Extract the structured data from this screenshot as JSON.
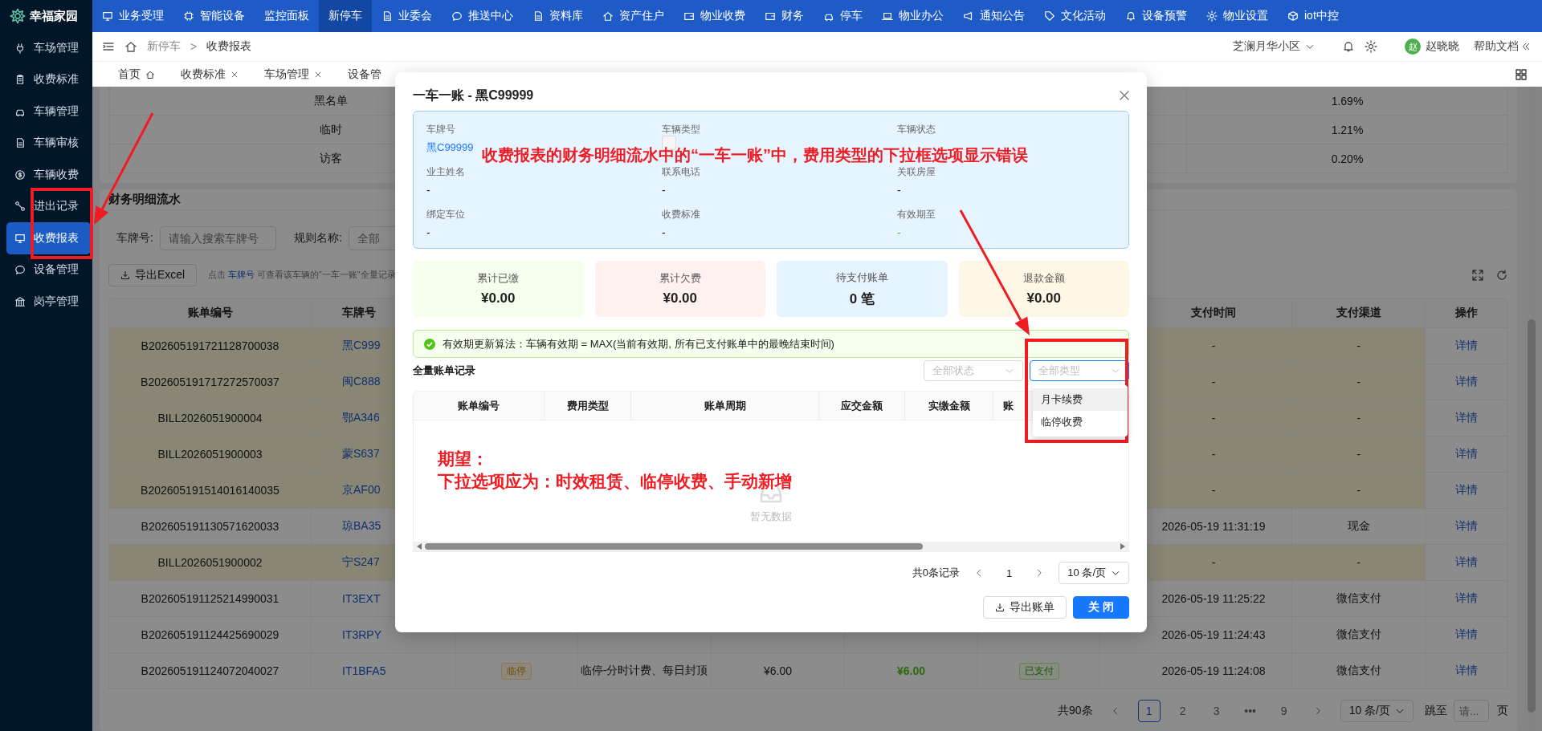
{
  "app": {
    "name": "幸福家园"
  },
  "top_nav": [
    {
      "label": "业务受理",
      "selected": false
    },
    {
      "label": "智能设备",
      "selected": false
    },
    {
      "label": "监控面板",
      "selected": false
    },
    {
      "label": "新停车",
      "selected": true
    },
    {
      "label": "业委会",
      "selected": false
    },
    {
      "label": "推送中心",
      "selected": false
    },
    {
      "label": "资料库",
      "selected": false
    },
    {
      "label": "资产住户",
      "selected": false
    },
    {
      "label": "物业收费",
      "selected": false
    },
    {
      "label": "财务",
      "selected": false
    },
    {
      "label": "停车",
      "selected": false
    },
    {
      "label": "物业办公",
      "selected": false
    },
    {
      "label": "通知公告",
      "selected": false
    },
    {
      "label": "文化活动",
      "selected": false
    },
    {
      "label": "设备预警",
      "selected": false
    },
    {
      "label": "物业设置",
      "selected": false
    },
    {
      "label": "iot中控",
      "selected": false
    }
  ],
  "sidebar": [
    {
      "label": "车场管理",
      "selected": false
    },
    {
      "label": "收费标准",
      "selected": false
    },
    {
      "label": "车辆管理",
      "selected": false
    },
    {
      "label": "车辆审核",
      "selected": false
    },
    {
      "label": "车辆收费",
      "selected": false
    },
    {
      "label": "进出记录",
      "selected": false
    },
    {
      "label": "收费报表",
      "selected": true
    },
    {
      "label": "设备管理",
      "selected": false
    },
    {
      "label": "岗亭管理",
      "selected": false
    }
  ],
  "breadcrumb": {
    "items": [
      "新停车",
      "收费报表"
    ],
    "separator": ">"
  },
  "header_right": {
    "community": "芝澜月华小区",
    "user_initial": "赵",
    "user_name": "赵晓晓",
    "help": "帮助文档"
  },
  "page_tabs": [
    {
      "label": "首页",
      "kind": "home",
      "closable": false
    },
    {
      "label": "收费标准",
      "kind": "page",
      "closable": true
    },
    {
      "label": "车场管理",
      "kind": "page",
      "closable": true
    },
    {
      "label": "设备管",
      "kind": "page",
      "closable": false
    }
  ],
  "summary_table": {
    "rows": [
      {
        "type": "黑名单",
        "ratio": "1.69%"
      },
      {
        "type": "临时",
        "ratio": "1.21%"
      },
      {
        "type": "访客",
        "ratio": "0.20%"
      }
    ]
  },
  "ledger": {
    "title": "财务明细流水",
    "filters": [
      {
        "label": "车牌号:",
        "placeholder": "请输入搜索车牌号"
      },
      {
        "label": "规则名称:",
        "placeholder": "全部"
      }
    ],
    "export_button": "导出Excel",
    "hint": {
      "before": "点击 ",
      "link": "车牌号",
      "after": " 可查看该车辆的\"一车一账\"全量记录"
    },
    "header": {
      "bill_no": "账单编号",
      "plate": "车牌号",
      "time": "支付时间",
      "channel": "支付渠道",
      "action": "操作"
    },
    "rows": [
      {
        "highlight": true,
        "bill_no": "B202605191721128700038",
        "plate": "黑C999",
        "time": "-",
        "channel": "-",
        "action": "详情"
      },
      {
        "highlight": true,
        "bill_no": "B202605191717272570037",
        "plate": "闽C888",
        "time": "-",
        "channel": "-",
        "action": "详情"
      },
      {
        "highlight": true,
        "bill_no": "BILL2026051900004",
        "plate": "鄂A346",
        "time": "-",
        "channel": "-",
        "action": "详情"
      },
      {
        "highlight": true,
        "bill_no": "BILL2026051900003",
        "plate": "蒙S637",
        "time": "-",
        "channel": "-",
        "action": "详情"
      },
      {
        "highlight": true,
        "bill_no": "B202605191514016140035",
        "plate": "京AF00",
        "time": "-",
        "channel": "-",
        "action": "详情"
      },
      {
        "highlight": false,
        "bill_no": "B202605191130571620033",
        "plate": "琼BA35",
        "time": "2026-05-19 11:31:19",
        "channel": "现金",
        "action": "详情"
      },
      {
        "highlight": true,
        "bill_no": "BILL2026051900002",
        "plate": "宁S247",
        "time": "-",
        "channel": "-",
        "action": "详情"
      },
      {
        "highlight": false,
        "bill_no": "B202605191125214990031",
        "plate": "IT3EXT",
        "time": "2026-05-19 11:25:22",
        "channel": "微信支付",
        "action": "详情"
      },
      {
        "highlight": false,
        "bill_no": "B202605191124425690029",
        "plate": "IT3RPY",
        "time": "2026-05-19 11:24:43",
        "channel": "微信支付",
        "action": "详情"
      },
      {
        "highlight": false,
        "bill_no": "B202605191124072040027",
        "plate": "IT1BFA5",
        "fee_type": "临停",
        "period": "临停-分时计费、每日封顶",
        "due": "¥6.00",
        "paid": "¥6.00",
        "status": "已支付",
        "time": "2026-05-19 11:24:08",
        "channel": "微信支付",
        "action": "详情"
      }
    ],
    "pagination": {
      "total": "共90条",
      "pages": [
        {
          "label": "1",
          "selected": true
        },
        {
          "label": "2",
          "selected": false
        },
        {
          "label": "3",
          "selected": false
        },
        {
          "label": "•••",
          "selected": false
        },
        {
          "label": "9",
          "selected": false
        }
      ],
      "page_size": "10 条/页",
      "jump_label": "跳至",
      "jump_placeholder": "请...",
      "page_suffix": "页"
    }
  },
  "modal": {
    "title": "一车一账 - 黑C99999",
    "info": [
      {
        "label": "车牌号",
        "value": "黑C99999",
        "kind": "link"
      },
      {
        "label": "车辆类型",
        "kind": "tag"
      },
      {
        "label": "车辆状态",
        "kind": "text"
      },
      {
        "label": "业主姓名",
        "value": "-",
        "kind": "text"
      },
      {
        "label": "联系电话",
        "value": "-",
        "kind": "text"
      },
      {
        "label": "关联房屋",
        "value": "-",
        "kind": "text"
      },
      {
        "label": "绑定车位",
        "value": "-",
        "kind": "text"
      },
      {
        "label": "收费标准",
        "value": "-",
        "kind": "text"
      },
      {
        "label": "有效期至",
        "value": "-",
        "kind": "success"
      }
    ],
    "stats": [
      {
        "label": "累计已缴",
        "value": "¥0.00",
        "color": "#f6ffed"
      },
      {
        "label": "累计欠费",
        "value": "¥0.00",
        "color": "#fff1f0"
      },
      {
        "label": "待支付账单",
        "value": "0 笔",
        "color": "#e6f4ff"
      },
      {
        "label": "退款金额",
        "value": "¥0.00",
        "color": "#fff7e6"
      }
    ],
    "notice": "有效期更新算法：车辆有效期 = MAX(当前有效期, 所有已支付账单中的最晚结束时间)",
    "records_title": "全量账单记录",
    "filters": [
      {
        "placeholder": "全部状态",
        "focused": false
      },
      {
        "placeholder": "全部类型",
        "focused": true
      }
    ],
    "dropdown": [
      {
        "label": "月卡续费",
        "active": true
      },
      {
        "label": "临停收费",
        "active": false
      }
    ],
    "columns": [
      "账单编号",
      "费用类型",
      "账单周期",
      "应交金额",
      "实缴金额",
      "账"
    ],
    "empty_text": "暂无数据",
    "pagination": {
      "total": "共0条记录",
      "page": "1",
      "page_size": "10 条/页"
    },
    "buttons": [
      {
        "label": "导出账单",
        "kind": "default"
      },
      {
        "label": "关 闭",
        "kind": "primary"
      }
    ]
  },
  "annotations": {
    "headline": "收费报表的财务明细流水中的“一车一账”中，费用类型的下拉框选项显示错误",
    "expectation": [
      "期望：",
      "下拉选项应为：时效租赁、临停收费、手动新增"
    ]
  }
}
